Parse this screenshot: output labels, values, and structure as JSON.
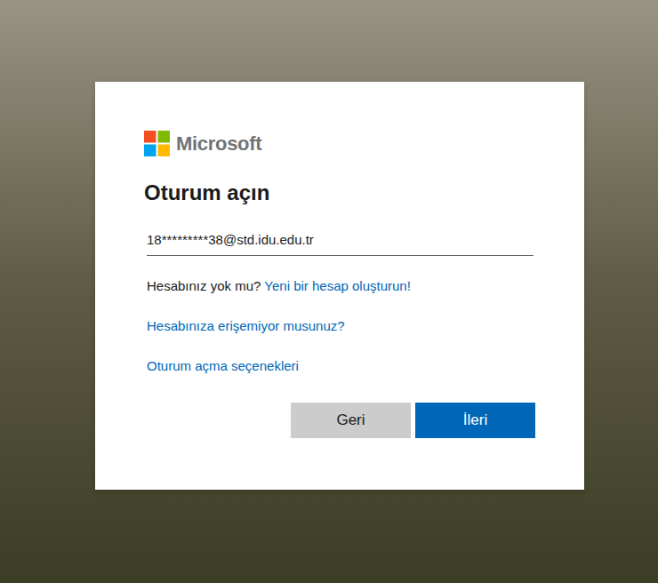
{
  "logo": {
    "text": "Microsoft"
  },
  "heading": "Oturum açın",
  "email_field": {
    "value": "18*********38@std.idu.edu.tr"
  },
  "no_account": {
    "prompt": "Hesabınız yok mu?",
    "link": "Yeni bir hesap oluşturun!"
  },
  "links": [
    "Hesabınıza erişemiyor musunuz?",
    "Oturum açma seçenekleri"
  ],
  "buttons": [
    {
      "label": "Geri",
      "kind": "secondary"
    },
    {
      "label": "İleri",
      "kind": "primary"
    }
  ]
}
